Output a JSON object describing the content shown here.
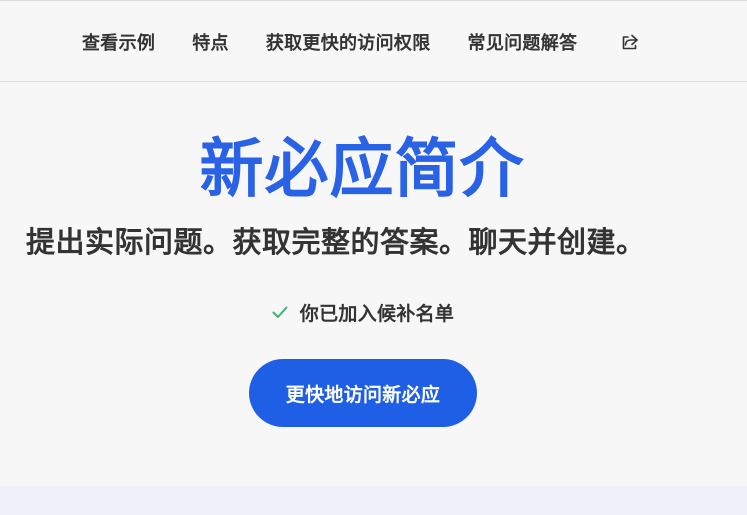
{
  "nav": {
    "items": [
      {
        "label": "查看示例"
      },
      {
        "label": "特点"
      },
      {
        "label": "获取更快的访问权限"
      },
      {
        "label": "常见问题解答"
      }
    ],
    "share_icon": "share-icon"
  },
  "hero": {
    "title": "新必应简介",
    "subtitle": "提出实际问题。获取完整的答案。聊天并创建。",
    "waitlist_status": "你已加入候补名单",
    "cta_label": "更快地访问新必应"
  },
  "colors": {
    "accent": "#2a62e6",
    "button": "#1f5fe6",
    "check": "#3cb371"
  }
}
